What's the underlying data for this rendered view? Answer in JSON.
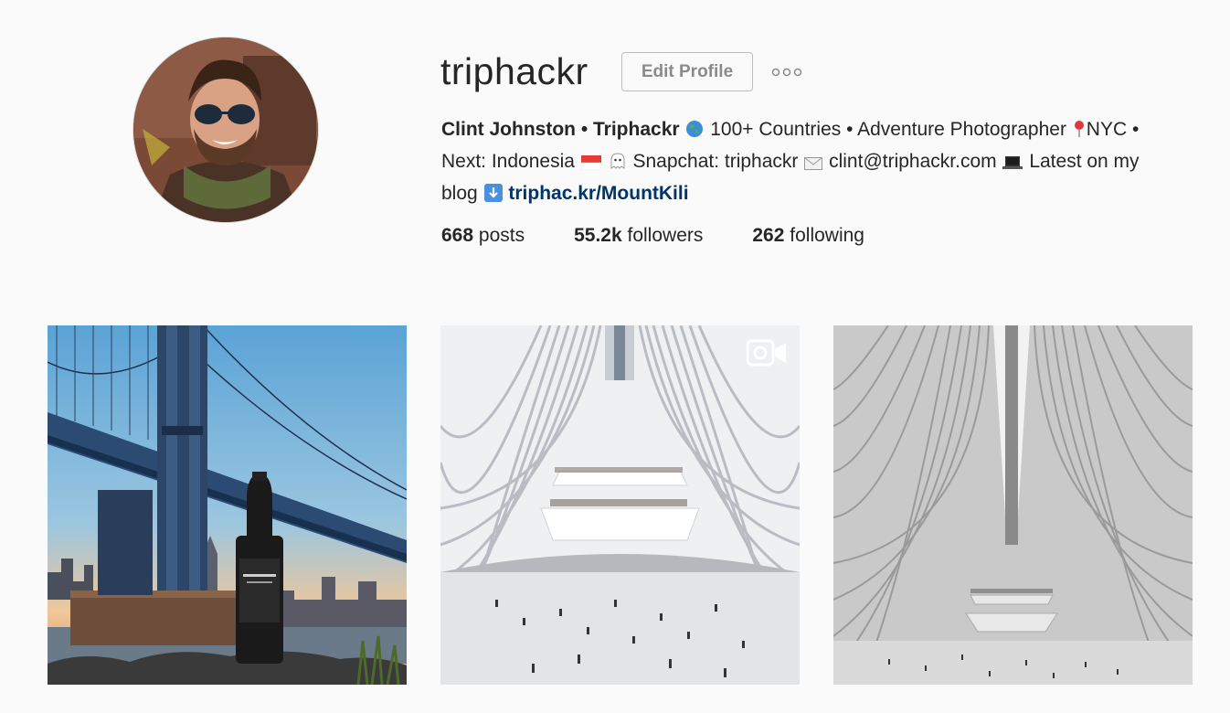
{
  "profile": {
    "username": "triphackr",
    "edit_profile_label": "Edit Profile",
    "more_icon": "more-options-icon",
    "bio": {
      "name": "Clint Johnston • Triphackr",
      "line1_rest": "100+ Countries • Adventure Photographer",
      "line1_tail": "NYC •",
      "next": "Next: Indonesia",
      "snapchat": "Snapchat: triphackr",
      "email": "clint@triphackr.com",
      "latest": "Latest on my",
      "blog": "blog",
      "link": "triphac.kr/MountKili"
    },
    "stats": {
      "posts_count": "668",
      "posts_label": "posts",
      "followers_count": "55.2k",
      "followers_label": "followers",
      "following_count": "262",
      "following_label": "following"
    }
  },
  "posts": [
    {
      "icon": "photo-manhattan-bridge-wine"
    },
    {
      "icon": "photo-oculus-interior",
      "video": true
    },
    {
      "icon": "photo-oculus-ceiling"
    }
  ],
  "colors": {
    "background": "#fafafa",
    "text": "#262626",
    "link": "#003569",
    "button_border": "#bdbdbd"
  }
}
